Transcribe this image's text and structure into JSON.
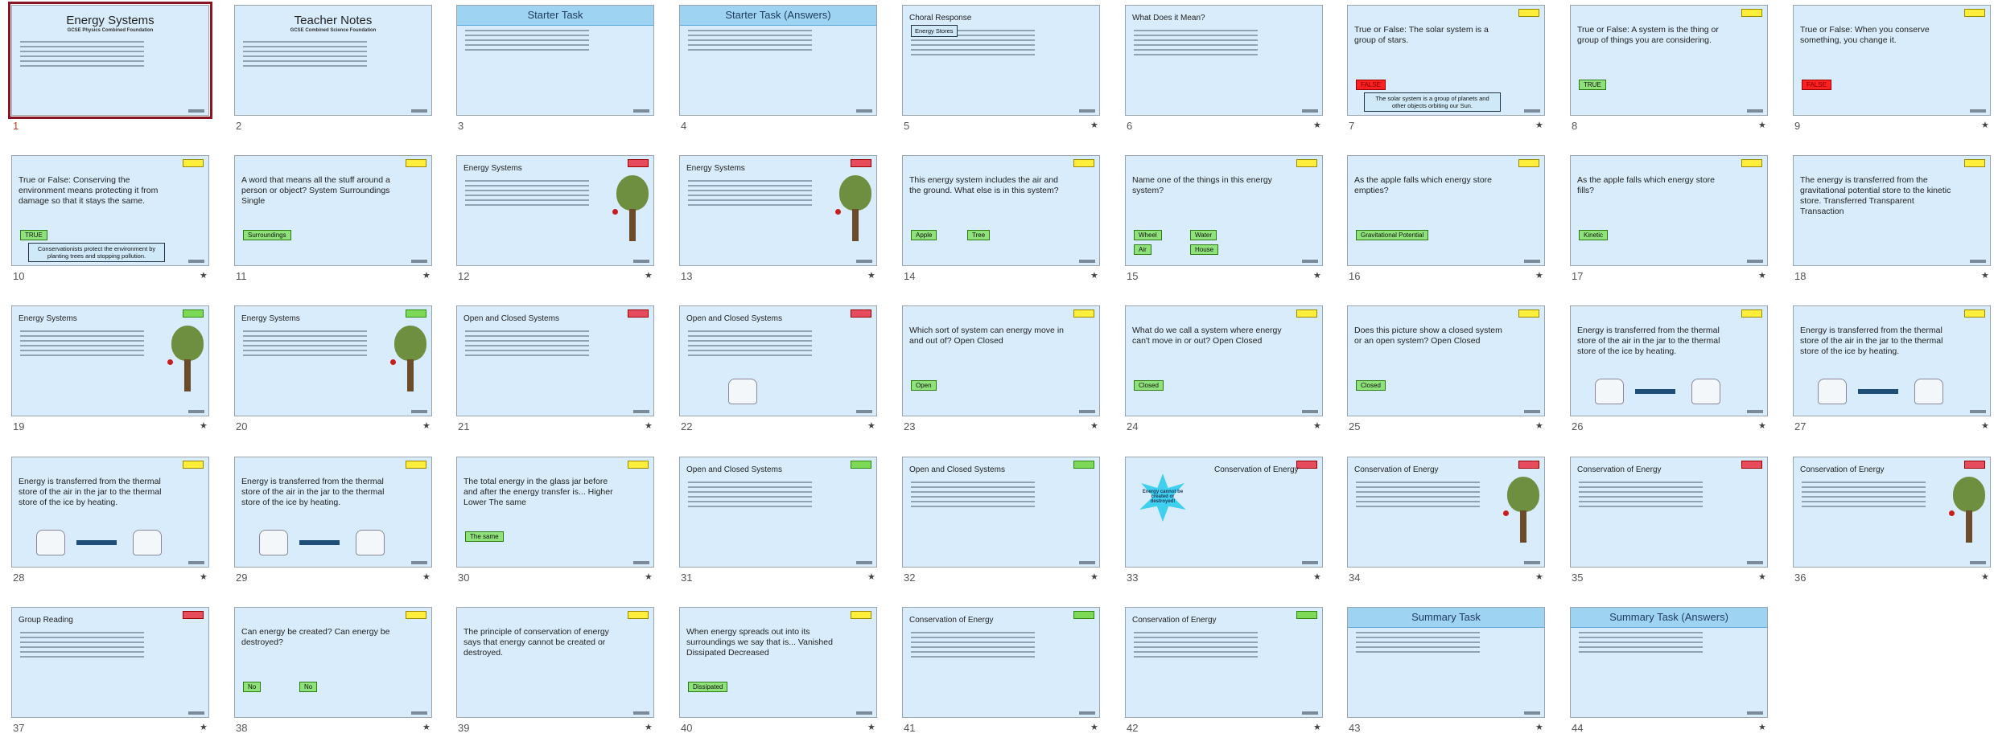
{
  "slides": [
    {
      "n": "1",
      "layout": "title",
      "title": "Energy Systems",
      "subtitle": "GCSE Physics Combined Foundation"
    },
    {
      "n": "2",
      "layout": "title",
      "title": "Teacher Notes",
      "subtitle": "GCSE Combined Science Foundation"
    },
    {
      "n": "3",
      "layout": "header",
      "title": "Starter Task"
    },
    {
      "n": "4",
      "layout": "header",
      "title": "Starter Task (Answers)"
    },
    {
      "n": "5",
      "layout": "heading",
      "title": "Choral Response",
      "boxes": [
        "Energy Stores"
      ]
    },
    {
      "n": "6",
      "layout": "heading",
      "title": "What Does it Mean?"
    },
    {
      "n": "7",
      "layout": "question",
      "tag": "y",
      "text": "True or False: The solar system is a group of stars.",
      "buttons": [
        {
          "t": "FALSE",
          "c": "red"
        }
      ],
      "boxes": [
        "The solar system is a group of planets and other objects orbiting our Sun."
      ]
    },
    {
      "n": "8",
      "layout": "question",
      "tag": "y",
      "text": "True or False: A system is the thing or group of things you are considering.",
      "buttons": [
        {
          "t": "TRUE",
          "c": "green"
        }
      ]
    },
    {
      "n": "9",
      "layout": "question",
      "tag": "y",
      "text": "True or False: When you conserve something, you change it.",
      "buttons": [
        {
          "t": "FALSE",
          "c": "red"
        }
      ]
    },
    {
      "n": "10",
      "layout": "question",
      "tag": "y",
      "text": "True or False: Conserving the environment means protecting it from damage so that it stays the same.",
      "buttons": [
        {
          "t": "TRUE",
          "c": "green"
        }
      ],
      "boxes": [
        "Conservationists protect the environment by planting trees and stopping pollution."
      ]
    },
    {
      "n": "11",
      "layout": "question",
      "tag": "y",
      "text": "A word that means all the stuff around a person or object? System Surroundings Single",
      "buttons": [
        {
          "t": "Surroundings",
          "c": "green"
        }
      ]
    },
    {
      "n": "12",
      "layout": "tree",
      "tag": "r",
      "title": "Energy Systems",
      "buttons": []
    },
    {
      "n": "13",
      "layout": "tree",
      "tag": "r",
      "title": "Energy Systems",
      "buttons": []
    },
    {
      "n": "14",
      "layout": "question",
      "tag": "y",
      "text": "This energy system includes the air and the ground. What else is in this system?",
      "buttons": [
        {
          "t": "Apple",
          "c": "green"
        },
        {
          "t": "Tree",
          "c": "green"
        }
      ]
    },
    {
      "n": "15",
      "layout": "question",
      "tag": "y",
      "text": "Name one of the things in this energy system?",
      "buttons": [
        {
          "t": "Wheel",
          "c": "green"
        },
        {
          "t": "Water",
          "c": "green"
        },
        {
          "t": "Air",
          "c": "green"
        },
        {
          "t": "House",
          "c": "green"
        }
      ]
    },
    {
      "n": "16",
      "layout": "question",
      "tag": "y",
      "text": "As the apple falls which energy store empties?",
      "buttons": [
        {
          "t": "Gravitational Potential",
          "c": "green"
        }
      ]
    },
    {
      "n": "17",
      "layout": "question",
      "tag": "y",
      "text": "As the apple falls which energy store fills?",
      "buttons": [
        {
          "t": "Kinetic",
          "c": "green"
        }
      ]
    },
    {
      "n": "18",
      "layout": "question",
      "tag": "y",
      "text": "The energy is transferred from the gravitational potential store to the kinetic store. Transferred Transparent Transaction",
      "buttons": []
    },
    {
      "n": "19",
      "layout": "tree",
      "tag": "g",
      "title": "Energy Systems",
      "buttons": []
    },
    {
      "n": "20",
      "layout": "tree",
      "tag": "g",
      "title": "Energy Systems",
      "buttons": []
    },
    {
      "n": "21",
      "layout": "heading",
      "tag": "r",
      "title": "Open and Closed Systems"
    },
    {
      "n": "22",
      "layout": "jar",
      "tag": "r",
      "title": "Open and Closed Systems"
    },
    {
      "n": "23",
      "layout": "question",
      "tag": "y",
      "text": "Which sort of system can energy move in and out of? Open Closed",
      "buttons": [
        {
          "t": "Open",
          "c": "green"
        }
      ]
    },
    {
      "n": "24",
      "layout": "question",
      "tag": "y",
      "text": "What do we call a system where energy can't move in or out? Open Closed",
      "buttons": [
        {
          "t": "Closed",
          "c": "green"
        }
      ]
    },
    {
      "n": "25",
      "layout": "question",
      "tag": "y",
      "text": "Does this picture show a closed system or an open system? Open Closed",
      "buttons": [
        {
          "t": "Closed",
          "c": "green"
        }
      ]
    },
    {
      "n": "26",
      "layout": "jarq",
      "tag": "y",
      "text": "Energy is transferred from the thermal store of the air in the jar to the thermal store of the ice by heating."
    },
    {
      "n": "27",
      "layout": "jarq",
      "tag": "y",
      "text": "Energy is transferred from the thermal store of the air in the jar to the thermal store of the ice by heating."
    },
    {
      "n": "28",
      "layout": "jarq",
      "tag": "y",
      "text": "Energy is transferred from the thermal store of the air in the jar to the thermal store of the ice by heating."
    },
    {
      "n": "29",
      "layout": "jarq",
      "tag": "y",
      "text": "Energy is transferred from the thermal store of the air in the jar to the thermal store of the ice by heating."
    },
    {
      "n": "30",
      "layout": "question",
      "tag": "y",
      "text": "The total energy in the glass jar before and after the energy transfer is... Higher Lower The same",
      "buttons": [
        {
          "t": "The same",
          "c": "green"
        }
      ]
    },
    {
      "n": "31",
      "layout": "heading",
      "tag": "g",
      "title": "Open and Closed Systems"
    },
    {
      "n": "32",
      "layout": "heading",
      "tag": "g",
      "title": "Open and Closed Systems"
    },
    {
      "n": "33",
      "layout": "starburst",
      "tag": "r",
      "title": "Conservation of Energy",
      "burst": "Energy cannot be created or destroyed!"
    },
    {
      "n": "34",
      "layout": "tree",
      "tag": "r",
      "title": "Conservation of Energy",
      "buttons": []
    },
    {
      "n": "35",
      "layout": "heading",
      "tag": "r",
      "title": "Conservation of Energy"
    },
    {
      "n": "36",
      "layout": "tree",
      "tag": "r",
      "title": "Conservation of Energy",
      "buttons": []
    },
    {
      "n": "37",
      "layout": "heading",
      "tag": "r",
      "title": "Group Reading"
    },
    {
      "n": "38",
      "layout": "question",
      "tag": "y",
      "text": "Can energy be created? Can energy be destroyed?",
      "buttons": [
        {
          "t": "No",
          "c": "green"
        },
        {
          "t": "No",
          "c": "green"
        }
      ]
    },
    {
      "n": "39",
      "layout": "question",
      "tag": "y",
      "text": "The principle of conservation of energy says that energy cannot be created or destroyed.",
      "buttons": []
    },
    {
      "n": "40",
      "layout": "question",
      "tag": "y",
      "text": "When energy spreads out into its surroundings we say that is... Vanished Dissipated Decreased",
      "buttons": [
        {
          "t": "Dissipated",
          "c": "green"
        }
      ]
    },
    {
      "n": "41",
      "layout": "heading",
      "tag": "g",
      "title": "Conservation of Energy"
    },
    {
      "n": "42",
      "layout": "heading",
      "tag": "g",
      "title": "Conservation of Energy"
    },
    {
      "n": "43",
      "layout": "header",
      "title": "Summary Task"
    },
    {
      "n": "44",
      "layout": "header",
      "title": "Summary Task (Answers)"
    }
  ]
}
